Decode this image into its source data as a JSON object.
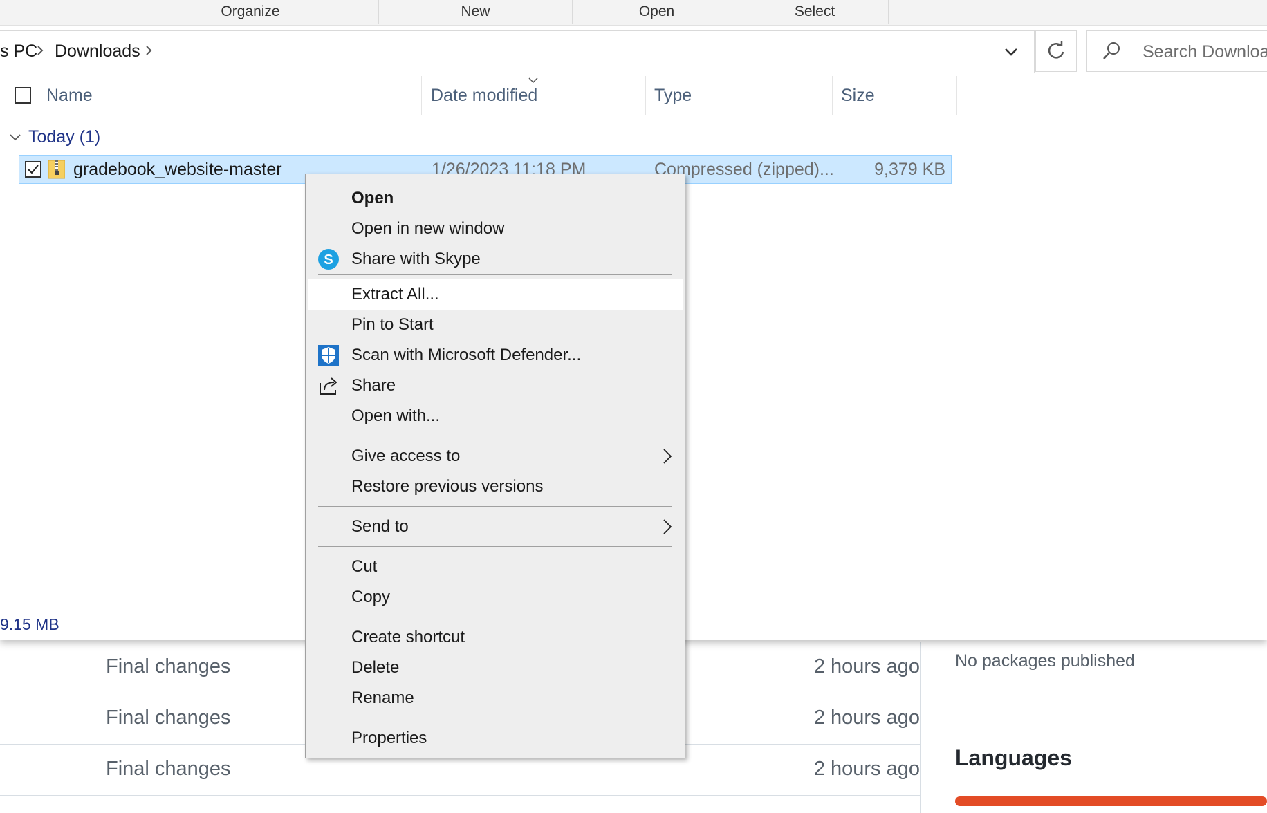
{
  "ribbon": {
    "groups": [
      "Organize",
      "New",
      "Open",
      "Select"
    ]
  },
  "address": {
    "crumbs": [
      "s PC",
      "Downloads"
    ],
    "search_placeholder": "Search Downloads"
  },
  "columns": {
    "name": "Name",
    "date_modified": "Date modified",
    "type": "Type",
    "size": "Size"
  },
  "group": {
    "label": "Today (1)"
  },
  "file": {
    "name": "gradebook_website-master",
    "date": "1/26/2023 11:18 PM",
    "type": "Compressed (zipped)...",
    "size": "9,379 KB",
    "selected": true
  },
  "status": {
    "selected_size": "9.15 MB"
  },
  "context_menu": {
    "items": [
      {
        "label": "Open",
        "bold": true
      },
      {
        "label": "Open in new window"
      },
      {
        "label": "Share with Skype",
        "icon": "skype-icon"
      },
      {
        "label": "Extract All...",
        "hover": true
      },
      {
        "label": "Pin to Start"
      },
      {
        "label": "Scan with Microsoft Defender...",
        "icon": "defender-shield-icon"
      },
      {
        "label": "Share",
        "icon": "share-icon"
      },
      {
        "label": "Open with..."
      },
      {
        "label": "Give access to",
        "submenu": true
      },
      {
        "label": "Restore previous versions"
      },
      {
        "label": "Send to",
        "submenu": true
      },
      {
        "label": "Cut"
      },
      {
        "label": "Copy"
      },
      {
        "label": "Create shortcut"
      },
      {
        "label": "Delete"
      },
      {
        "label": "Rename"
      },
      {
        "label": "Properties"
      }
    ]
  },
  "background_page": {
    "commits": [
      {
        "message": "Final changes",
        "time": "2 hours ago"
      },
      {
        "message": "Final changes",
        "time": "2 hours ago"
      },
      {
        "message": "Final changes",
        "time": "2 hours ago"
      }
    ],
    "no_packages": "No packages published",
    "languages_title": "Languages"
  },
  "colors": {
    "selection_bg": "#cce8ff",
    "menu_bg": "#eeeeee",
    "language_bar": "#e34c26",
    "group_label": "#1e3287"
  }
}
